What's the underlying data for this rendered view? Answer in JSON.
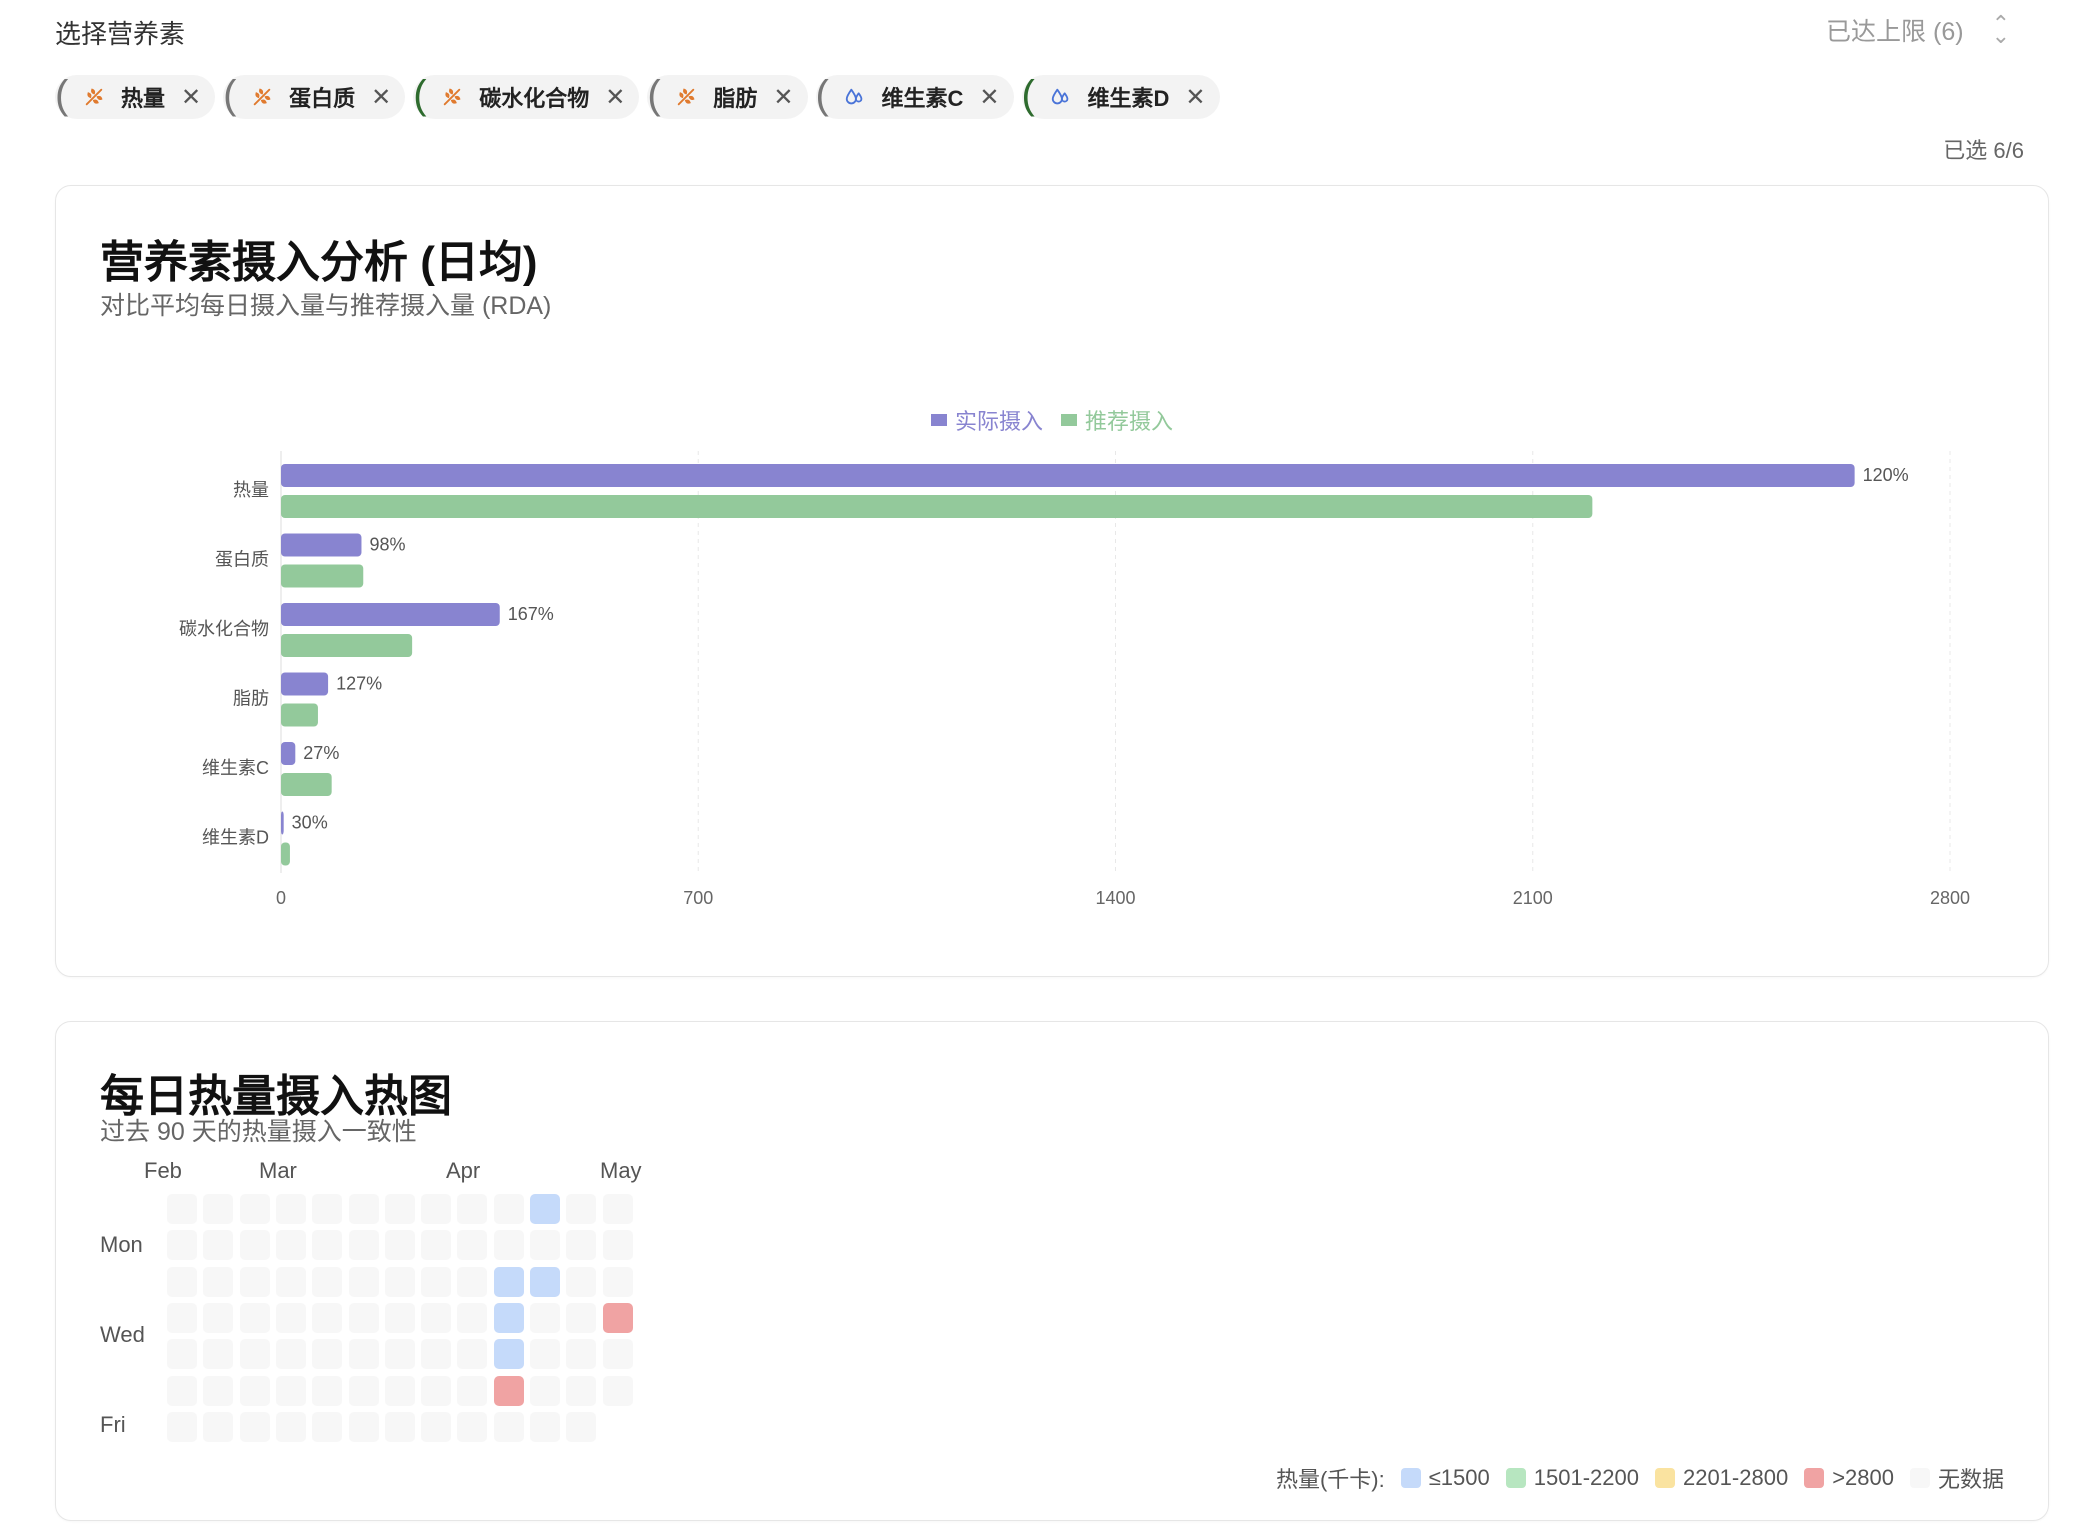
{
  "selector": {
    "label": "选择营养素",
    "status": "已达上限 (6)",
    "count": "已选 6/6",
    "chips": [
      {
        "name": "热量",
        "icon": "grain-icon",
        "paren_color": "gray"
      },
      {
        "name": "蛋白质",
        "icon": "grain-icon",
        "paren_color": "gray"
      },
      {
        "name": "碳水化合物",
        "icon": "grain-icon",
        "paren_color": "green"
      },
      {
        "name": "脂肪",
        "icon": "grain-icon",
        "paren_color": "gray"
      },
      {
        "name": "维生素C",
        "icon": "drop-icon",
        "paren_color": "gray"
      },
      {
        "name": "维生素D",
        "icon": "drop-icon",
        "paren_color": "green"
      }
    ],
    "remove_icon": "close-icon"
  },
  "intake_card": {
    "title": "营养素摄入分析 (日均)",
    "subtitle": "对比平均每日摄入量与推荐摄入量 (RDA)"
  },
  "chart_data": {
    "type": "bar",
    "orientation": "horizontal",
    "categories": [
      "热量",
      "蛋白质",
      "碳水化合物",
      "脂肪",
      "维生素C",
      "维生素D"
    ],
    "series": [
      {
        "name": "实际摄入",
        "color": "#8884d0",
        "values": [
          2640,
          135,
          367,
          79,
          24,
          4.5
        ]
      },
      {
        "name": "推荐摄入",
        "color": "#93c99b",
        "values": [
          2200,
          138,
          220,
          62,
          85,
          15
        ]
      }
    ],
    "data_labels": [
      "120%",
      "98%",
      "167%",
      "127%",
      "27%",
      "30%"
    ],
    "x_ticks": [
      "0",
      "700",
      "1400",
      "2100",
      "2800"
    ],
    "xlim": [
      0,
      2800
    ],
    "legend_position": "top-center",
    "grid": "vertical-dashed"
  },
  "heatmap_card": {
    "title": "每日热量摄入热图",
    "subtitle": "过去 90 天的热量摄入一致性",
    "months": [
      "Feb",
      "Mar",
      "Apr",
      "May"
    ],
    "day_labels": [
      "Mon",
      "Wed",
      "Fri"
    ],
    "weeks": 13,
    "active_cells": [
      {
        "week": 10,
        "day": 0,
        "level": "low"
      },
      {
        "week": 9,
        "day": 2,
        "level": "low"
      },
      {
        "week": 10,
        "day": 2,
        "level": "low"
      },
      {
        "week": 9,
        "day": 3,
        "level": "low"
      },
      {
        "week": 12,
        "day": 3,
        "level": "over"
      },
      {
        "week": 9,
        "day": 4,
        "level": "low"
      },
      {
        "week": 9,
        "day": 5,
        "level": "over"
      }
    ],
    "missing_cells": [
      {
        "week": 12,
        "day": 6
      }
    ],
    "legend": {
      "title": "热量(千卡):",
      "items": [
        {
          "label": "≤1500",
          "color": "#c5dafa"
        },
        {
          "label": "1501-2200",
          "color": "#b7e6c0"
        },
        {
          "label": "2201-2800",
          "color": "#fae3a0"
        },
        {
          "label": ">2800",
          "color": "#f0a3a3"
        },
        {
          "label": "无数据",
          "color": "#f7f7f7"
        }
      ]
    }
  }
}
